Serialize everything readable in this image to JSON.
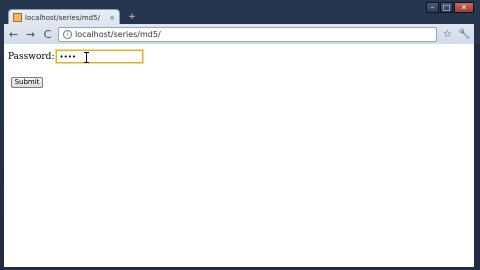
{
  "window": {
    "controls": {
      "minimize": "–",
      "maximize": "□",
      "close": "✕"
    }
  },
  "tab": {
    "title": "localhost/series/md5/",
    "close_glyph": "×",
    "favicon": "page-icon"
  },
  "new_tab_glyph": "+",
  "toolbar": {
    "back_glyph": "←",
    "forward_glyph": "→",
    "reload_glyph": "C",
    "url": "localhost/series/md5/",
    "star_glyph": "☆",
    "wrench_glyph": "🔧"
  },
  "form": {
    "password_label": "Password:",
    "password_value": "••••",
    "submit_label": "Submit"
  },
  "colors": {
    "frame": "#27364f",
    "focus_ring": "#f3dd84"
  }
}
